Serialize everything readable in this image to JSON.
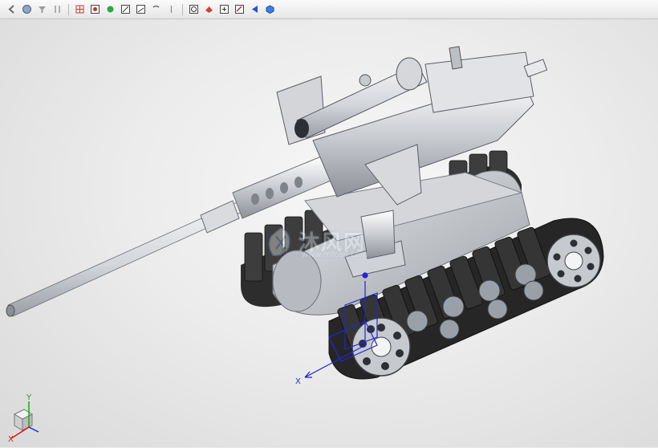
{
  "toolbar": {
    "icons": [
      "back-icon",
      "orbit-icon",
      "filter-icon",
      "sort-icon",
      "grid-icon",
      "snap-point-icon",
      "snap-green-icon",
      "line-tool-icon",
      "angle-tool-icon",
      "rotate-icon",
      "refresh-icon",
      "paint-icon",
      "insert-icon",
      "measure-icon",
      "arrow-icon",
      "cube-view-icon"
    ]
  },
  "viewport": {
    "background_color": "#e9e9ea",
    "model_colors": {
      "metal": "#bfc3c9",
      "track": "#2d2d2d",
      "highlight": "#ffffff",
      "csys": "#2424d8"
    },
    "model_description": "Tracked robot chassis with mounted heavy machine gun and scope"
  },
  "csys": {
    "x_label": "X",
    "y_label": "Y",
    "z_label": ""
  },
  "triad": {
    "x_label": "X",
    "y_label": "Y",
    "x_color": "#d11a1a",
    "y_color": "#1aa51a"
  },
  "watermark": {
    "text": "沐风网",
    "url": "www.mfcad.com"
  }
}
